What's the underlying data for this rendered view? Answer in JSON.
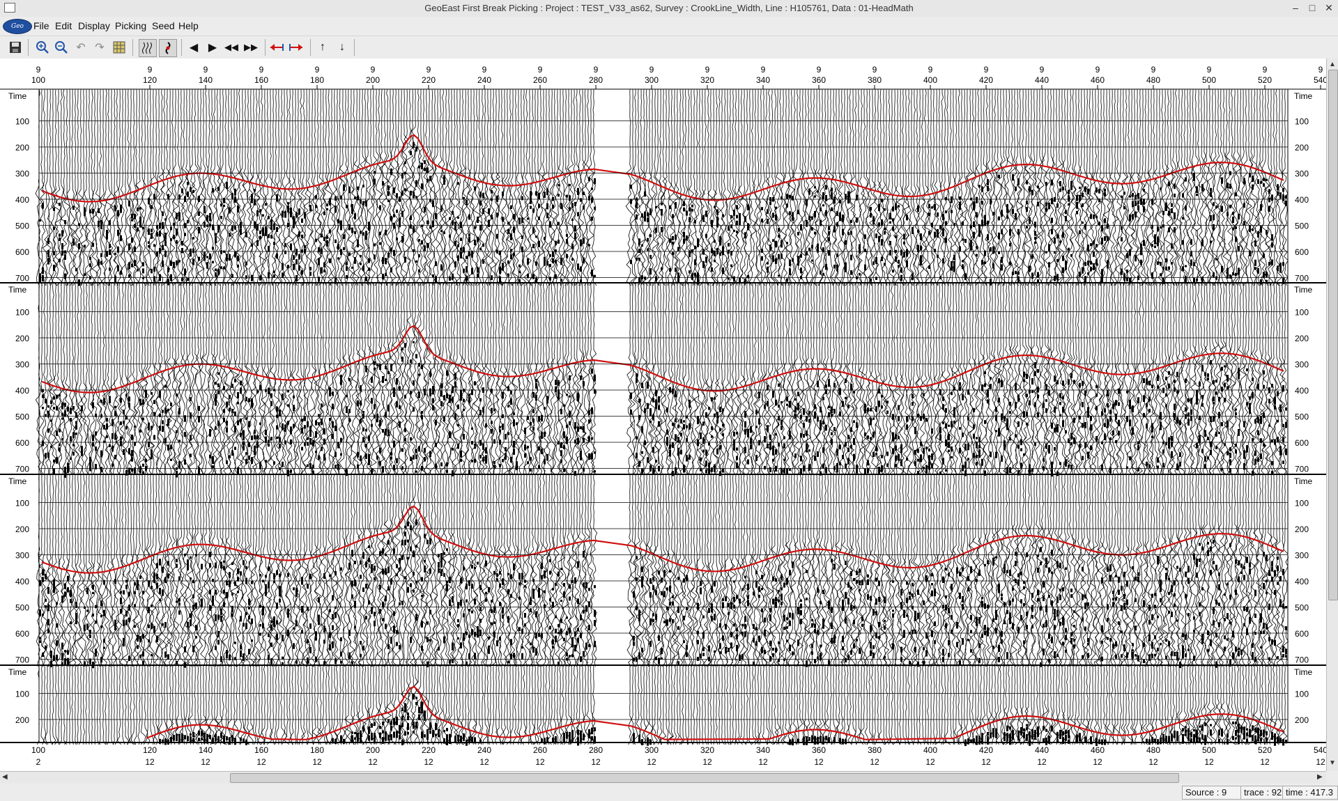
{
  "window": {
    "title": "GeoEast First Break Picking : Project : TEST_V33_as62,  Survey : CrookLine_Width,  Line : H105761,  Data : 01-HeadMath",
    "minimize": "–",
    "maximize": "□",
    "close": "✕"
  },
  "menu": {
    "logo": "Geo East",
    "items": [
      "File",
      "Edit",
      "Display",
      "Picking",
      "Seed",
      "Help"
    ]
  },
  "toolbar": {
    "icons": [
      "save-icon",
      "zoom-in-icon",
      "zoom-out-icon",
      "undo-icon",
      "redo-icon",
      "grid-icon",
      "wiggle-display-icon",
      "pick-icon",
      "prev-icon",
      "next-icon",
      "first-icon",
      "last-icon",
      "shift-left-icon",
      "shift-right-icon",
      "up-icon",
      "down-icon"
    ]
  },
  "axis": {
    "top_row_value": "9",
    "bottom_row_value": "12",
    "first_left_label": "2",
    "tick_labels": [
      "100",
      "120",
      "140",
      "160",
      "180",
      "200",
      "220",
      "240",
      "260",
      "280",
      "300",
      "320",
      "340",
      "360",
      "380",
      "400",
      "420",
      "440",
      "460",
      "480",
      "500",
      "520",
      "540"
    ],
    "time_label": "Time",
    "time_ticks": [
      "100",
      "200",
      "300",
      "400",
      "500",
      "600",
      "700"
    ],
    "panel4_time_ticks": [
      "100",
      "200"
    ]
  },
  "colors": {
    "pick": "#d01010",
    "trace": "#000000",
    "background": "#ffffff"
  },
  "status": {
    "source": "Source : 9",
    "trace": "trace : 92",
    "time": "time : 417.3"
  }
}
